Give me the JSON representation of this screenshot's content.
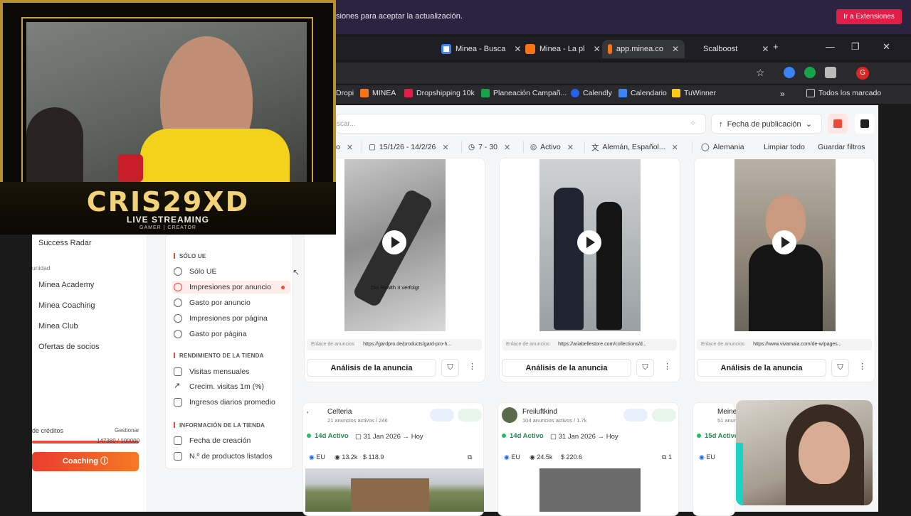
{
  "notification": {
    "text": "siones para aceptar la actualización.",
    "button": "Ir a Extensiones"
  },
  "tabs": [
    {
      "label": "Minea - Busca",
      "color": "#fbbc05"
    },
    {
      "label": "Minea - La pl",
      "color": "#f97316"
    },
    {
      "label": "app.minea.co",
      "color": "#f97316"
    },
    {
      "label": "Scalboost",
      "color": "#2a2a2e"
    }
  ],
  "bookmarks": [
    {
      "label": "Dropi",
      "color": "#4285f4"
    },
    {
      "label": "MINEA",
      "color": "#f97316"
    },
    {
      "label": "Dropshipping 10k",
      "color": "#e11d48"
    },
    {
      "label": "Planeación Campañ...",
      "color": "#16a34a"
    },
    {
      "label": "Calendly",
      "color": "#2563eb"
    },
    {
      "label": "Calendario",
      "color": "#3b82f6"
    },
    {
      "label": "TuWinner",
      "color": "#facc15"
    },
    {
      "label": "Todos los marcado",
      "color": "#e5e5e5"
    }
  ],
  "sidebar": {
    "success_radar": "Success Radar",
    "community_head": "unidad",
    "items": [
      "Minea Academy",
      "Minea Coaching",
      "Minea Club",
      "Ofertas de socios"
    ],
    "credits_label": "de créditos",
    "credits_manage": "Gestionar",
    "credits_value": "147380 / 100000",
    "credits_fill": 1.0,
    "coaching": "Coaching"
  },
  "filters": {
    "section1": "SÓLO UE",
    "items1": [
      "Sólo UE",
      "Impresiones por anuncio",
      "Gasto por anuncio",
      "Impresiones por página",
      "Gasto por página"
    ],
    "section2": "RENDIMIENTO DE LA TIENDA",
    "items2": [
      "Visitas mensuales",
      "Crecim. visitas 1m (%)",
      "Ingresos diarios promedio"
    ],
    "section3": "INFORMACIÓN DE LA TIENDA",
    "items3": [
      "Fecha de creación",
      "N.º de productos listados"
    ]
  },
  "search": {
    "placeholder": "scar...",
    "sort": "Fecha de publicación"
  },
  "chips": [
    "o",
    "15/1/26 - 14/2/26",
    "7 - 30",
    "Activo",
    "Alemán, Español...",
    "Alemania"
  ],
  "chip_actions": {
    "clear": "Limpiar todo",
    "save": "Guardar filtros"
  },
  "ads": [
    {
      "link_label": "Enlace de anuncios",
      "link": "https://gardpro.de/products/gard-pro-h...",
      "subtitle": "Die Health 3 verfolgt",
      "action": "Análisis de la anuncia"
    },
    {
      "link_label": "Enlace de anuncios",
      "link": "https://ariabellestore.com/collections/d...",
      "action": "Análisis de la anuncia"
    },
    {
      "link_label": "Enlace de anuncios",
      "link": "https://www.vivamaia.com/de-w/pages...",
      "action": "Análisis de la anuncia"
    }
  ],
  "stores": [
    {
      "name": "Celteria",
      "sub": "21 anuncios activos / 246",
      "badge": "14d Activo",
      "date": "31 Jan 2026",
      "end": "Hoy",
      "region": "EU",
      "views": "13.2k",
      "spend": "118.9",
      "copies": ""
    },
    {
      "name": "Freiluftkind",
      "sub": "104 anuncios activos / 1.7k",
      "badge": "14d Activo",
      "date": "31 Jan 2026",
      "end": "Hoy",
      "region": "EU",
      "views": "24.5k",
      "spend": "220.6",
      "copies": "1"
    },
    {
      "name": "Meine",
      "sub": "51 anun",
      "badge": "15d Activo",
      "region": "EU"
    }
  ],
  "overlay": {
    "brand": "CRIS29XD",
    "live": "LIVE STREAMING",
    "tag": "GAMER | CREATOR"
  }
}
